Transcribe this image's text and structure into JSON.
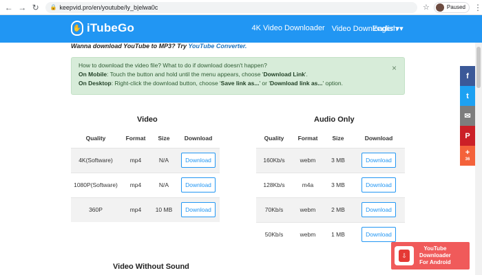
{
  "browser": {
    "url": "keepvid.pro/en/youtube/ly_b|elwa0c",
    "status": "Paused"
  },
  "header": {
    "logo": "iTubeGo",
    "nav": [
      "4K Video Downloader",
      "Video Downloader ▾"
    ],
    "language": "English ▾"
  },
  "promo": {
    "text": "Wanna download YouTube to MP3? Try",
    "link": "YouTube Converter."
  },
  "notice": {
    "line1": "How to download the video file? What to do if download doesn't happen?",
    "mobile_label": "On Mobile",
    "mobile_text_a": ": Touch the button and hold until the menu appears, choose '",
    "mobile_bold": "Download Link",
    "mobile_text_b": "'.",
    "desktop_label": "On Desktop",
    "desktop_text_a": ": Right-click the download button, choose '",
    "desktop_bold1": "Save link as...",
    "desktop_text_b": "' or '",
    "desktop_bold2": "Download link as...",
    "desktop_text_c": "' option.",
    "close": "×"
  },
  "video": {
    "title": "Video",
    "headers": [
      "Quality",
      "Format",
      "Size",
      "Download"
    ],
    "rows": [
      {
        "quality": "4K(Software)",
        "format": "mp4",
        "size": "N/A",
        "button": "Download"
      },
      {
        "quality": "1080P(Software)",
        "format": "mp4",
        "size": "N/A",
        "button": "Download"
      },
      {
        "quality": "360P",
        "format": "mp4",
        "size": "10 MB",
        "button": "Download"
      }
    ]
  },
  "audio": {
    "title": "Audio Only",
    "headers": [
      "Quality",
      "Format",
      "Size",
      "Download"
    ],
    "rows": [
      {
        "quality": "160Kb/s",
        "format": "webm",
        "size": "3 MB",
        "button": "Download"
      },
      {
        "quality": "128Kb/s",
        "format": "m4a",
        "size": "3 MB",
        "button": "Download"
      },
      {
        "quality": "70Kb/s",
        "format": "webm",
        "size": "2 MB",
        "button": "Download"
      },
      {
        "quality": "50Kb/s",
        "format": "webm",
        "size": "1 MB",
        "button": "Download"
      }
    ]
  },
  "video_no_sound": {
    "title": "Video Without Sound"
  },
  "social": {
    "facebook": "f",
    "twitter": "t",
    "email": "✉",
    "pinterest": "P",
    "more": "+",
    "more_count": "36"
  },
  "app_promo": {
    "line1": "YouTube",
    "line2": "Downloader",
    "line3": "For Android"
  },
  "colors": {
    "header": "#2196f3",
    "notice_bg": "#d7ecd9",
    "facebook": "#3b5998",
    "twitter": "#1da1f2",
    "email": "#7d7d7d",
    "pinterest": "#cb2027",
    "more": "#f4623a",
    "app_promo": "#f05a5a"
  }
}
